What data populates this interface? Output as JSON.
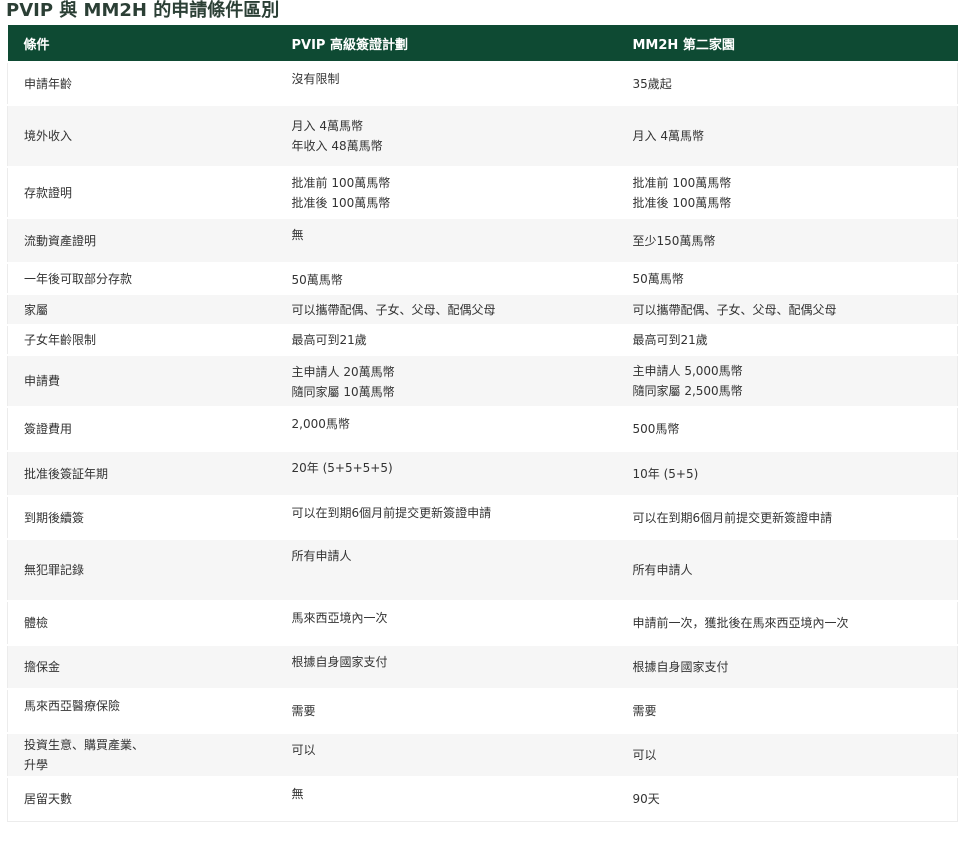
{
  "title": "PVIP 與 MM2H 的申請條件區別",
  "headers": [
    "條件",
    "PVIP 高級簽證計劃",
    "MM2H 第二家園"
  ],
  "rows": [
    {
      "c1": [
        "申請年齡"
      ],
      "c2": [
        "沒有限制"
      ],
      "c3": [
        "35歲起"
      ]
    },
    {
      "c1": [
        "境外收入"
      ],
      "c2": [
        "月入 4萬馬幣",
        "年收入 48萬馬幣"
      ],
      "c3": [
        "月入 4萬馬幣"
      ]
    },
    {
      "c1": [
        "存款證明"
      ],
      "c2": [
        "批准前 100萬馬幣",
        "批准後 100萬馬幣"
      ],
      "c3": [
        "批准前 100萬馬幣",
        "批准後 100萬馬幣"
      ]
    },
    {
      "c1": [
        "流動資產證明"
      ],
      "c2": [
        "無"
      ],
      "c3": [
        "至少150萬馬幣"
      ]
    },
    {
      "c1": [
        "一年後可取部分存款"
      ],
      "c2": [
        "50萬馬幣"
      ],
      "c3": [
        "50萬馬幣"
      ]
    },
    {
      "c1": [
        "家屬"
      ],
      "c2": [
        "可以攜帶配偶、子女、父母、配偶父母"
      ],
      "c3": [
        "可以攜帶配偶、子女、父母、配偶父母"
      ]
    },
    {
      "c1": [
        "子女年齡限制"
      ],
      "c2": [
        "最高可到21歲"
      ],
      "c3": [
        "最高可到21歲"
      ]
    },
    {
      "c1": [
        "申請費"
      ],
      "c2": [
        "主申請人 20萬馬幣",
        "隨同家屬 10萬馬幣"
      ],
      "c3": [
        "主申請人 5,000馬幣",
        "隨同家屬 2,500馬幣"
      ]
    },
    {
      "c1": [
        "簽證費用"
      ],
      "c2": [
        "2,000馬幣"
      ],
      "c3": [
        "500馬幣"
      ]
    },
    {
      "c1": [
        "批准後簽証年期"
      ],
      "c2": [
        "20年 (5+5+5+5)"
      ],
      "c3": [
        "10年 (5+5)"
      ]
    },
    {
      "c1": [
        "到期後續簽"
      ],
      "c2": [
        "可以在到期6個月前提交更新簽證申請"
      ],
      "c3": [
        "可以在到期6個月前提交更新簽證申請"
      ]
    },
    {
      "c1": [
        "無犯罪記錄"
      ],
      "c2": [
        "所有申請人"
      ],
      "c3": [
        "所有申請人"
      ]
    },
    {
      "c1": [
        "體檢"
      ],
      "c2": [
        "馬來西亞境內一次"
      ],
      "c3": [
        "申請前一次，獲批後在馬來西亞境內一次"
      ]
    },
    {
      "c1": [
        "擔保金"
      ],
      "c2": [
        "根據自身國家支付"
      ],
      "c3": [
        "根據自身國家支付"
      ]
    },
    {
      "c1": [
        "馬來西亞醫療保險"
      ],
      "c2": [
        "需要"
      ],
      "c3": [
        "需要"
      ]
    },
    {
      "c1": [
        "投資生意、購買產業、",
        "升學"
      ],
      "c2": [
        "可以"
      ],
      "c3": [
        "可以"
      ]
    },
    {
      "c1": [
        "居留天數"
      ],
      "c2": [
        "無"
      ],
      "c3": [
        "90天"
      ]
    }
  ]
}
